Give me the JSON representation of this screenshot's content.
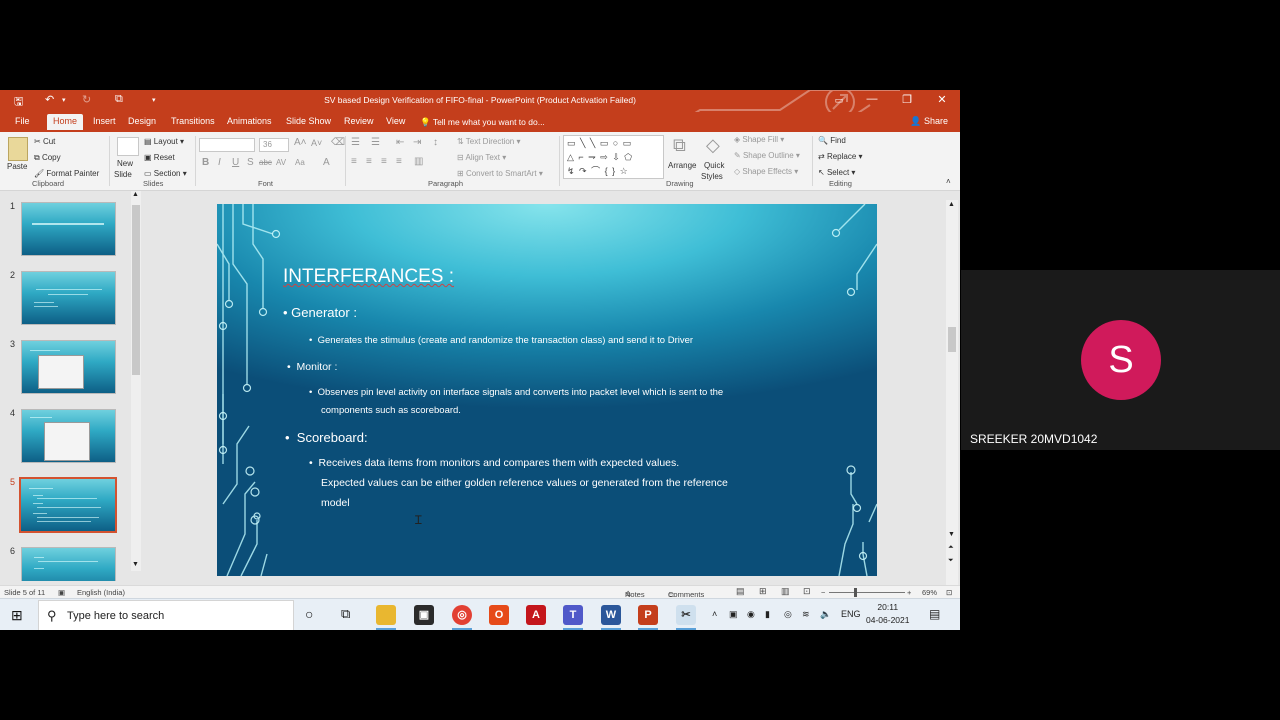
{
  "window": {
    "title": "SV based Design Verification of FIFO-final  -  PowerPoint (Product Activation Failed)",
    "minimize": "—",
    "restore": "❐",
    "close": "✕"
  },
  "tabs": [
    "File",
    "Home",
    "Insert",
    "Design",
    "Transitions",
    "Animations",
    "Slide Show",
    "Review",
    "View"
  ],
  "tell_me": "Tell me what you want to do...",
  "share": "Share",
  "ribbon": {
    "clipboard": {
      "paste": "Paste",
      "cut": "Cut",
      "copy": "Copy",
      "format_painter": "Format Painter",
      "label": "Clipboard"
    },
    "slides": {
      "new_slide": "New",
      "new_slide2": "Slide",
      "layout": "Layout",
      "reset": "Reset",
      "section": "Section",
      "label": "Slides"
    },
    "font": {
      "size": "36",
      "label": "Font"
    },
    "paragraph": {
      "text_direction": "Text Direction",
      "align_text": "Align Text",
      "convert_smartart": "Convert to SmartArt",
      "label": "Paragraph"
    },
    "drawing": {
      "arrange": "Arrange",
      "quick": "Quick",
      "styles": "Styles",
      "shape_fill": "Shape Fill",
      "shape_outline": "Shape Outline",
      "shape_effects": "Shape Effects",
      "label": "Drawing"
    },
    "editing": {
      "find": "Find",
      "replace": "Replace",
      "select": "Select",
      "label": "Editing"
    }
  },
  "thumbnails": [
    "1",
    "2",
    "3",
    "4",
    "5",
    "6"
  ],
  "slide": {
    "title": "INTERFERANCES :",
    "items": [
      {
        "head": "Generator :",
        "detail": "Generates the stimulus (create and randomize the transaction class) and send it to Driver"
      },
      {
        "head": "Monitor :",
        "detail_line1": "Observes pin level activity on interface signals and converts into packet level which is sent to the",
        "detail_line2": "components such as scoreboard."
      },
      {
        "head": "Scoreboard:",
        "detail_line1": "Receives data items from monitors and compares them with expected values.",
        "detail_line2": "Expected values can be either golden reference values or generated from the reference",
        "detail_line3": "model"
      }
    ]
  },
  "status": {
    "slide_of": "Slide 5 of 11",
    "language": "English (India)",
    "notes": "Notes",
    "comments": "Comments",
    "zoom": "69%"
  },
  "taskbar": {
    "search_placeholder": "Type here to search",
    "lang": "ENG",
    "time": "20:11",
    "date": "04-06-2021"
  },
  "participant": {
    "initial": "S",
    "name": "SREEKER 20MVD1042",
    "avatar_color": "#d01a5b"
  }
}
